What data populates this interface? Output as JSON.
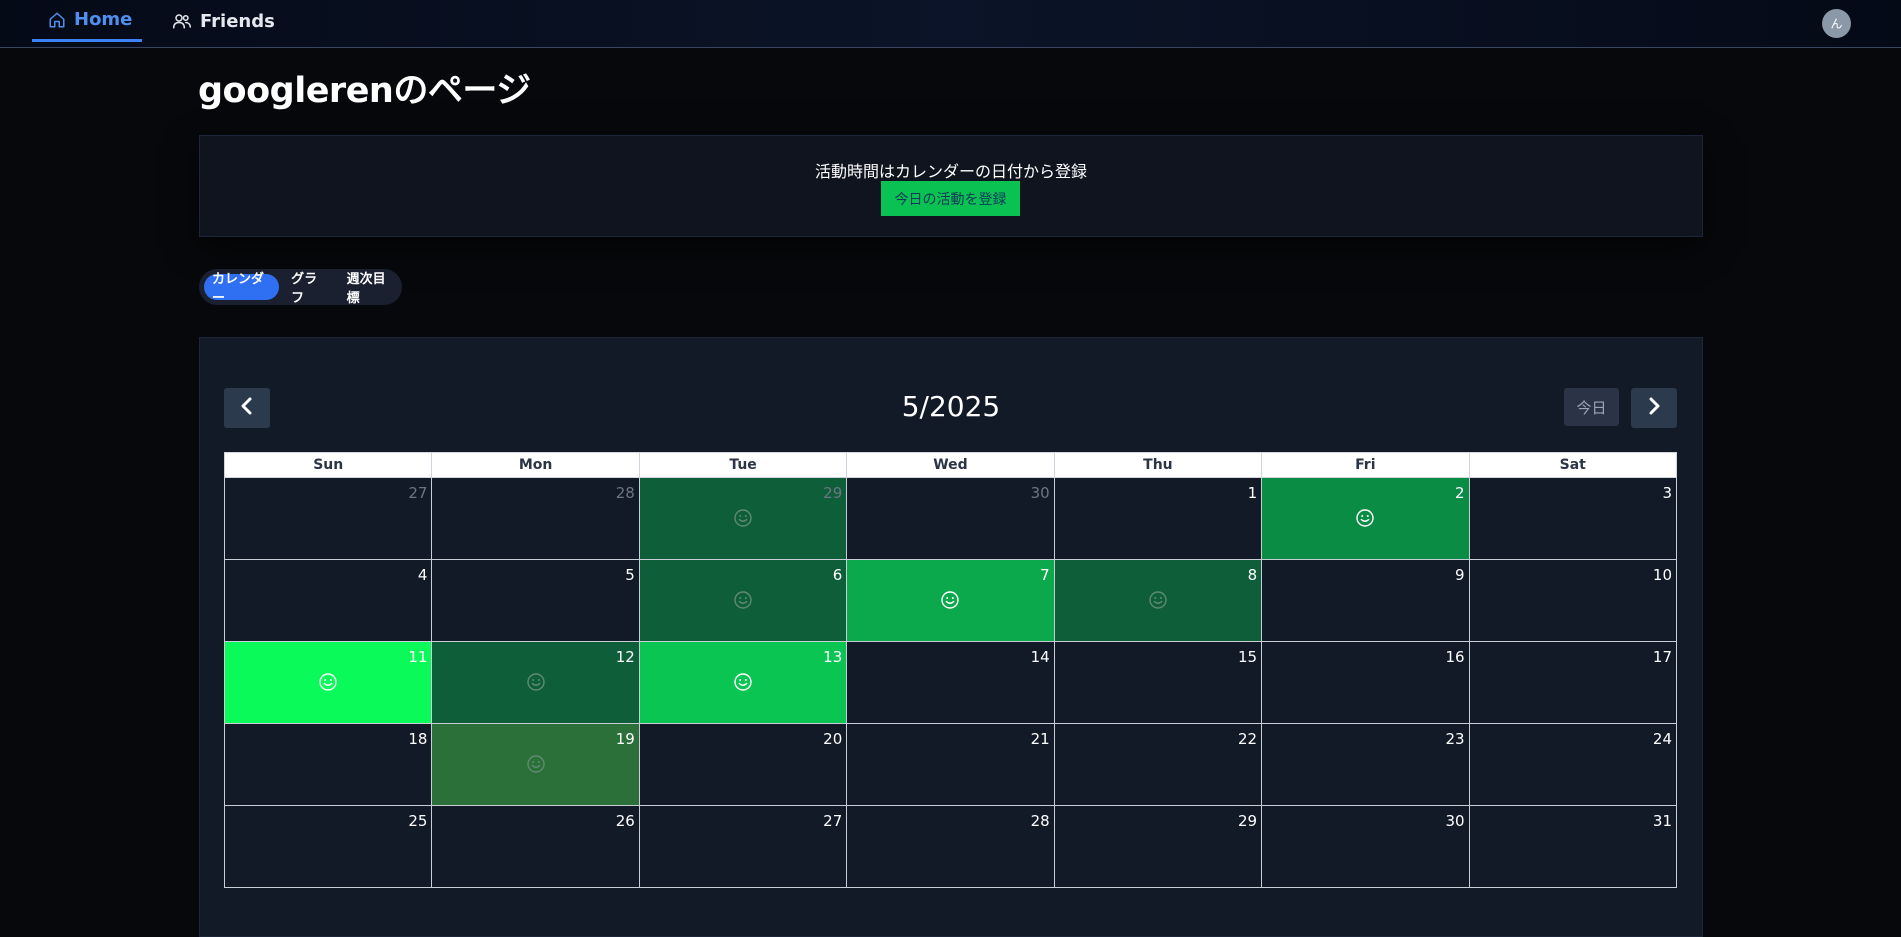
{
  "nav": {
    "home_label": "Home",
    "friends_label": "Friends",
    "avatar_initial": "ん"
  },
  "page": {
    "title": "googlerenのページ"
  },
  "register": {
    "hint": "活動時間はカレンダーの日付から登録",
    "button_label": "今日の活動を登録"
  },
  "tabs": [
    {
      "label": "カレンダー",
      "active": true
    },
    {
      "label": "グラフ",
      "active": false
    },
    {
      "label": "週次目標",
      "active": false
    }
  ],
  "calendar": {
    "title": "5/2025",
    "today_label": "今日",
    "weekdays": [
      "Sun",
      "Mon",
      "Tue",
      "Wed",
      "Thu",
      "Fri",
      "Sat"
    ],
    "weeks": [
      [
        {
          "day": "27",
          "other": true,
          "color": null
        },
        {
          "day": "28",
          "other": true,
          "color": null
        },
        {
          "day": "29",
          "other": true,
          "color": "#0f5e3a"
        },
        {
          "day": "30",
          "other": true,
          "color": null
        },
        {
          "day": "1",
          "other": false,
          "color": null
        },
        {
          "day": "2",
          "other": false,
          "color": "#0a8c45"
        },
        {
          "day": "3",
          "other": false,
          "color": null
        }
      ],
      [
        {
          "day": "4",
          "other": false,
          "color": null
        },
        {
          "day": "5",
          "other": false,
          "color": null
        },
        {
          "day": "6",
          "other": false,
          "color": "#0f5e3a"
        },
        {
          "day": "7",
          "other": false,
          "color": "#0ca84c"
        },
        {
          "day": "8",
          "other": false,
          "color": "#0f5e3a"
        },
        {
          "day": "9",
          "other": false,
          "color": null
        },
        {
          "day": "10",
          "other": false,
          "color": null
        }
      ],
      [
        {
          "day": "11",
          "other": false,
          "color": "#0afa5a"
        },
        {
          "day": "12",
          "other": false,
          "color": "#0f5e3a"
        },
        {
          "day": "13",
          "other": false,
          "color": "#0bc553"
        },
        {
          "day": "14",
          "other": false,
          "color": null
        },
        {
          "day": "15",
          "other": false,
          "color": null
        },
        {
          "day": "16",
          "other": false,
          "color": null
        },
        {
          "day": "17",
          "other": false,
          "color": null
        }
      ],
      [
        {
          "day": "18",
          "other": false,
          "color": null
        },
        {
          "day": "19",
          "other": false,
          "color": "#2a7038"
        },
        {
          "day": "20",
          "other": false,
          "color": null
        },
        {
          "day": "21",
          "other": false,
          "color": null
        },
        {
          "day": "22",
          "other": false,
          "color": null
        },
        {
          "day": "23",
          "other": false,
          "color": null
        },
        {
          "day": "24",
          "other": false,
          "color": null
        }
      ],
      [
        {
          "day": "25",
          "other": false,
          "color": null
        },
        {
          "day": "26",
          "other": false,
          "color": null
        },
        {
          "day": "27",
          "other": false,
          "color": null
        },
        {
          "day": "28",
          "other": false,
          "color": null
        },
        {
          "day": "29",
          "other": false,
          "color": null
        },
        {
          "day": "30",
          "other": false,
          "color": null
        },
        {
          "day": "31",
          "other": false,
          "color": null
        }
      ]
    ]
  }
}
